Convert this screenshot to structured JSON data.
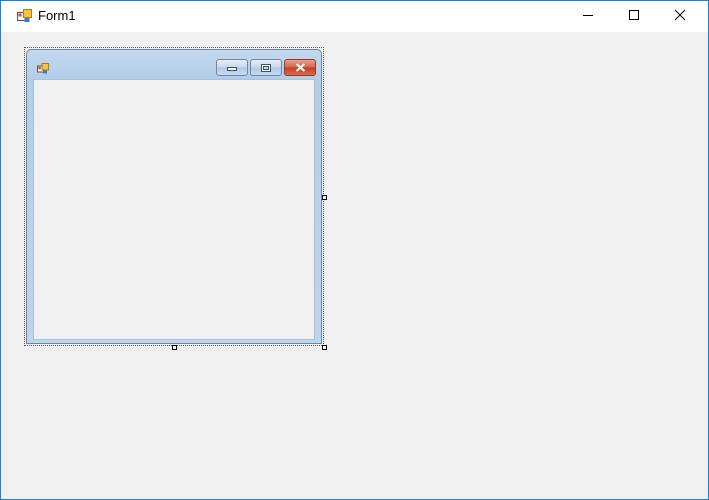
{
  "window": {
    "title": "Form1",
    "icon": "form-icon",
    "controls": {
      "minimize_icon": "minimize-icon",
      "maximize_icon": "maximize-icon",
      "close_icon": "close-icon"
    },
    "border_color": "#1883d7",
    "background_color": "#f0f0f0"
  },
  "designer": {
    "child_form": {
      "icon": "form-icon",
      "controls": {
        "minimize_icon": "minimize-icon",
        "restore_icon": "restore-icon",
        "close_icon": "close-icon"
      },
      "frame_color": "#b9d1ea",
      "close_button_color": "#c94a32"
    },
    "selection_handles": [
      "right-middle",
      "bottom-middle",
      "bottom-right"
    ]
  }
}
